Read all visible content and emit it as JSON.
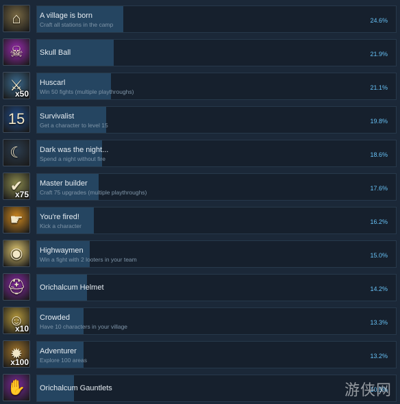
{
  "achievements": [
    {
      "title": "A village is born",
      "desc": "Craft all stations in the camp",
      "percent_label": "24.6%",
      "percent": 24.6,
      "icon": "village-hut-icon",
      "glyph": "⌂",
      "icon_bg": "#7a6a44",
      "mult": ""
    },
    {
      "title": "Skull Ball",
      "desc": "",
      "percent_label": "21.9%",
      "percent": 21.9,
      "icon": "skull-icon",
      "glyph": "☠",
      "icon_bg": "#9a2bb0",
      "mult": ""
    },
    {
      "title": "Huscarl",
      "desc": "Win 50 fights (multiple playthroughs)",
      "percent_label": "21.1%",
      "percent": 21.1,
      "icon": "armored-warrior-icon",
      "glyph": "⚔",
      "icon_bg": "#3b6a8e",
      "mult": "x50"
    },
    {
      "title": "Survivalist",
      "desc": "Get a character to level 15",
      "percent_label": "19.8%",
      "percent": 19.8,
      "icon": "level-15-badge-icon",
      "glyph": "15",
      "icon_bg": "#1f4a86",
      "mult": ""
    },
    {
      "title": "Dark was the night...",
      "desc": "Spend a night without fire",
      "percent_label": "18.6%",
      "percent": 18.6,
      "icon": "night-monster-icon",
      "glyph": "☾",
      "icon_bg": "#2c3d4f",
      "mult": ""
    },
    {
      "title": "Master builder",
      "desc": "Craft 75 upgrades (multiple playthroughs)",
      "percent_label": "17.6%",
      "percent": 17.6,
      "icon": "checklist-grid-icon",
      "glyph": "✔",
      "icon_bg": "#8b8a4e",
      "mult": "x75"
    },
    {
      "title": "You're fired!",
      "desc": "Kick a character",
      "percent_label": "16.2%",
      "percent": 16.2,
      "icon": "pointing-hand-icon",
      "glyph": "☛",
      "icon_bg": "#d28a1f",
      "mult": ""
    },
    {
      "title": "Highwaymen",
      "desc": "Win a fight with 2 looters in your team",
      "percent_label": "15.0%",
      "percent": 15.0,
      "icon": "loot-bag-icon",
      "glyph": "◉",
      "icon_bg": "#e0c770",
      "mult": ""
    },
    {
      "title": "Orichalcum Helmet",
      "desc": "",
      "percent_label": "14.2%",
      "percent": 14.2,
      "icon": "helmet-icon",
      "glyph": "⛑",
      "icon_bg": "#8a2aa8",
      "mult": ""
    },
    {
      "title": "Crowded",
      "desc": "Have 10 characters in your village",
      "percent_label": "13.3%",
      "percent": 13.3,
      "icon": "villager-face-icon",
      "glyph": "☺",
      "icon_bg": "#b79a3d",
      "mult": "x10"
    },
    {
      "title": "Adventurer",
      "desc": "Explore 100 areas",
      "percent_label": "13.2%",
      "percent": 13.2,
      "icon": "compass-map-icon",
      "glyph": "✹",
      "icon_bg": "#a0742c",
      "mult": "x100"
    },
    {
      "title": "Orichalcum Gauntlets",
      "desc": "",
      "percent_label": "10.5%",
      "percent": 10.5,
      "icon": "gauntlet-icon",
      "glyph": "✋",
      "icon_bg": "#7b2a9a",
      "mult": ""
    }
  ],
  "watermark": "游侠网"
}
